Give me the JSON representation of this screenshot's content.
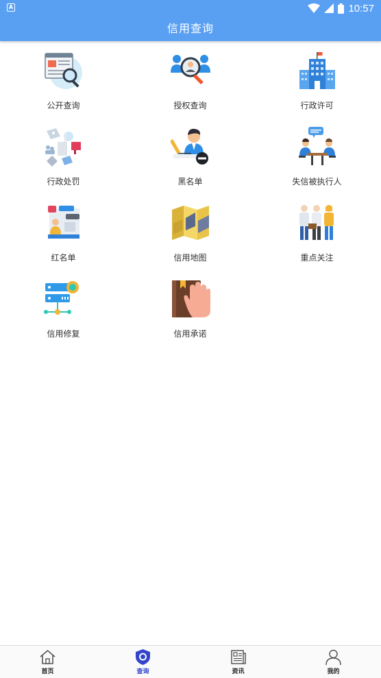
{
  "statusbar": {
    "time": "10:57"
  },
  "header": {
    "title": "信用查询"
  },
  "grid": {
    "items": [
      {
        "label": "公开查询",
        "icon": "public-search-icon"
      },
      {
        "label": "授权查询",
        "icon": "authorized-search-icon"
      },
      {
        "label": "行政许可",
        "icon": "government-building-icon"
      },
      {
        "label": "行政处罚",
        "icon": "penalty-icon"
      },
      {
        "label": "黑名单",
        "icon": "blacklist-icon"
      },
      {
        "label": "失信被执行人",
        "icon": "meeting-icon"
      },
      {
        "label": "红名单",
        "icon": "redlist-icon"
      },
      {
        "label": "信用地图",
        "icon": "map-icon"
      },
      {
        "label": "重点关注",
        "icon": "people-icon"
      },
      {
        "label": "信用修复",
        "icon": "repair-server-icon"
      },
      {
        "label": "信用承诺",
        "icon": "promise-hand-icon"
      }
    ]
  },
  "tabbar": {
    "items": [
      {
        "label": "首页",
        "icon": "home-icon"
      },
      {
        "label": "查询",
        "icon": "shield-icon",
        "active": true
      },
      {
        "label": "资讯",
        "icon": "news-icon"
      },
      {
        "label": "我的",
        "icon": "profile-icon"
      }
    ]
  },
  "colors": {
    "primary": "#5aa0f2",
    "active_tab": "#3344cc"
  }
}
